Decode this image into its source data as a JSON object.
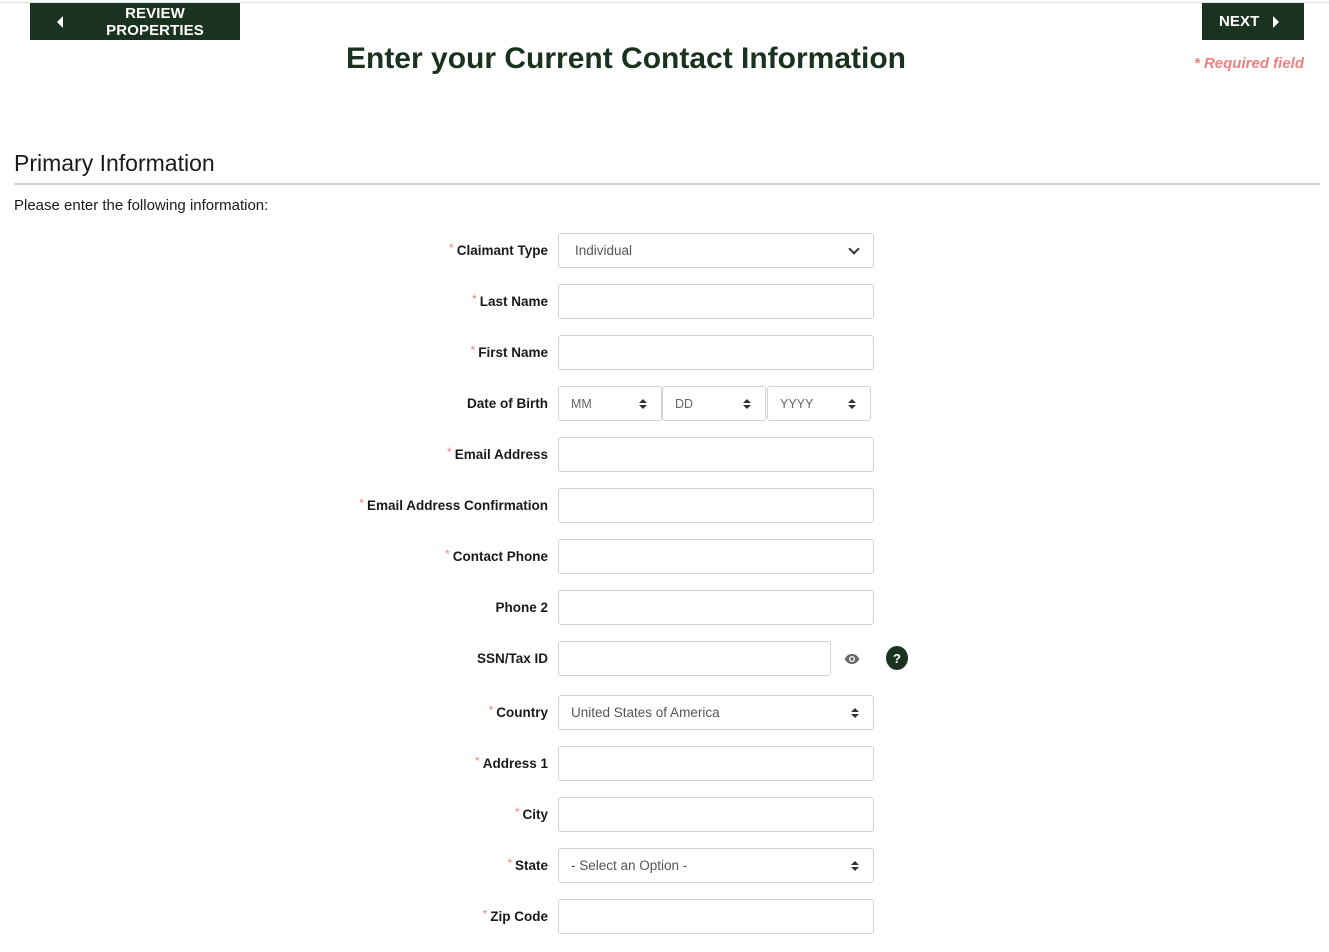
{
  "nav": {
    "back_label": "REVIEW PROPERTIES",
    "next_label": "NEXT"
  },
  "header": {
    "title": "Enter your Current Contact Information",
    "required_note": "* Required field"
  },
  "section": {
    "title": "Primary Information",
    "intro": "Please enter the following information:"
  },
  "colors": {
    "brand_dark_green": "#1a3320",
    "required_red": "#f07f7f"
  },
  "form": {
    "claimant_type": {
      "label": "Claimant Type",
      "required": true,
      "value": "Individual"
    },
    "last_name": {
      "label": "Last Name",
      "required": true,
      "value": ""
    },
    "first_name": {
      "label": "First Name",
      "required": true,
      "value": ""
    },
    "date_of_birth": {
      "label": "Date of Birth",
      "required": false,
      "month": "MM",
      "day": "DD",
      "year": "YYYY"
    },
    "email": {
      "label": "Email Address",
      "required": true,
      "value": ""
    },
    "email_confirm": {
      "label": "Email Address Confirmation",
      "required": true,
      "value": ""
    },
    "contact_phone": {
      "label": "Contact Phone",
      "required": true,
      "value": ""
    },
    "phone2": {
      "label": "Phone 2",
      "required": false,
      "value": ""
    },
    "ssn": {
      "label": "SSN/Tax ID",
      "required": false,
      "value": "",
      "help_glyph": "?"
    },
    "country": {
      "label": "Country",
      "required": true,
      "value": "United States of America"
    },
    "address1": {
      "label": "Address 1",
      "required": true,
      "value": ""
    },
    "city": {
      "label": "City",
      "required": true,
      "value": ""
    },
    "state": {
      "label": "State",
      "required": true,
      "value": "- Select an Option -"
    },
    "zip": {
      "label": "Zip Code",
      "required": true,
      "value": ""
    }
  },
  "required_marker": "*"
}
